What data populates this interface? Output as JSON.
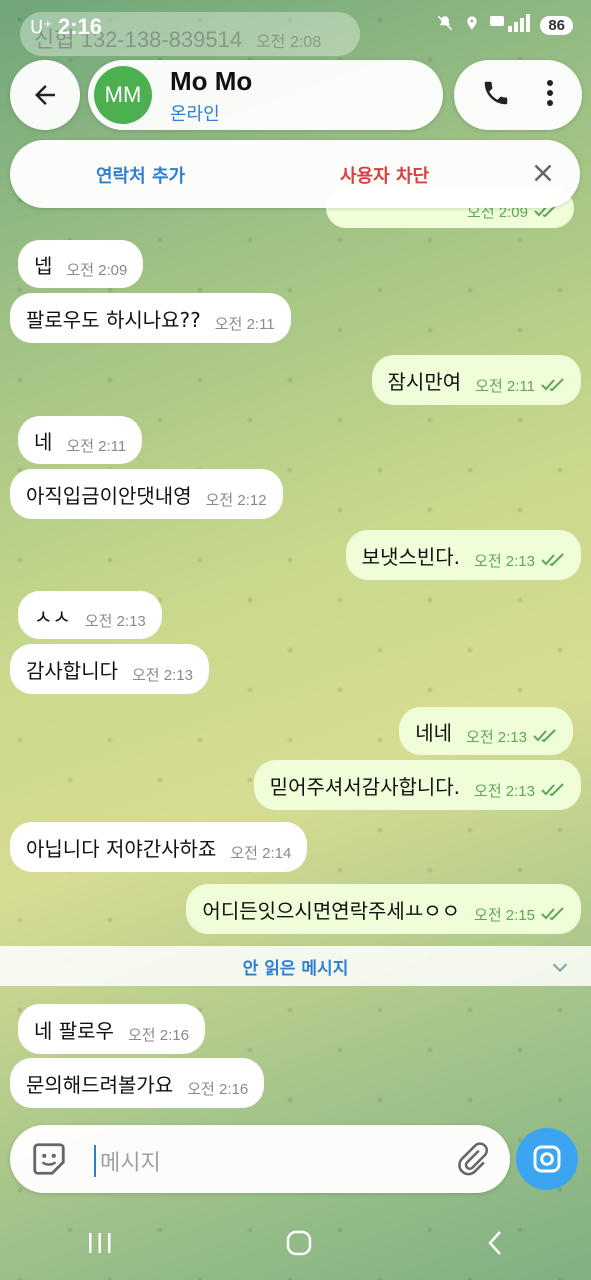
{
  "status": {
    "carrier": "U⁺",
    "time": "2:16",
    "battery": "86"
  },
  "pinned": {
    "text": "신협 132-138-839514",
    "time": "오전 2:08"
  },
  "header": {
    "avatar_initials": "MM",
    "name": "Mo Mo",
    "status": "온라인"
  },
  "action_bar": {
    "add_contact": "연락처 추가",
    "block_user": "사용자 차단"
  },
  "messages": [
    {
      "dir": "in",
      "text": "넵",
      "time": "오전 2:09"
    },
    {
      "dir": "in",
      "text": "팔로우도 하시나요??",
      "time": "오전 2:11"
    },
    {
      "dir": "out",
      "text": "잠시만여",
      "time": "오전 2:11"
    },
    {
      "dir": "in",
      "text": "네",
      "time": "오전 2:11"
    },
    {
      "dir": "in",
      "text": "아직입금이안댓내영",
      "time": "오전 2:12"
    },
    {
      "dir": "out",
      "text": "보냇스빈다.",
      "time": "오전 2:13"
    },
    {
      "dir": "in",
      "text": "ㅅㅅ",
      "time": "오전 2:13"
    },
    {
      "dir": "in",
      "text": "감사합니다",
      "time": "오전 2:13"
    },
    {
      "dir": "out",
      "text": "네네",
      "time": "오전 2:13"
    },
    {
      "dir": "out",
      "text": "믿어주셔서감사합니다.",
      "time": "오전 2:13"
    },
    {
      "dir": "in",
      "text": "아닙니다 저야간사하죠",
      "time": "오전 2:14"
    },
    {
      "dir": "out",
      "text": "어디든잇으시면연락주세ㅛㅇㅇ",
      "time": "오전 2:15"
    },
    {
      "dir": "in",
      "text": "네 팔로우",
      "time": "오전 2:16"
    },
    {
      "dir": "in",
      "text": "문의해드려볼가요",
      "time": "오전 2:16"
    }
  ],
  "partial_top_message": {
    "time": "오전 2:09"
  },
  "unread_divider": "안 읽은 메시지",
  "composer": {
    "placeholder": "메시지"
  },
  "colors": {
    "accent": "#2f7fd0",
    "block": "#d64040",
    "outgoing_bubble": "#effed9",
    "avatar": "#4cb050",
    "camera": "#3ba5f2"
  }
}
